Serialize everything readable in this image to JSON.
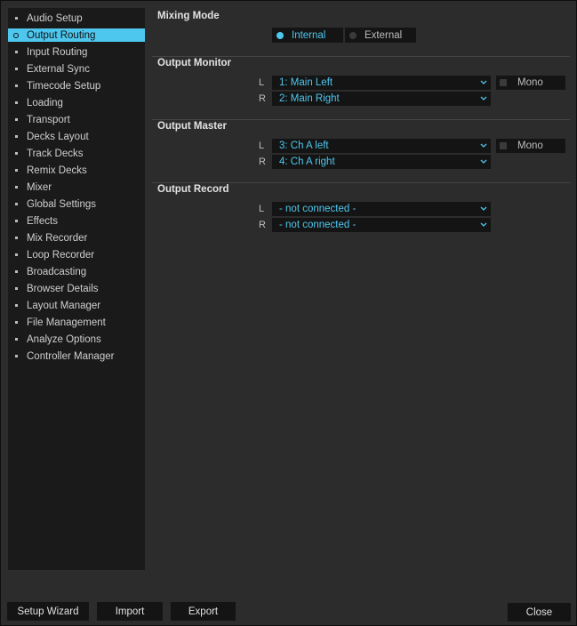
{
  "sidebar": {
    "items": [
      {
        "label": "Audio Setup"
      },
      {
        "label": "Output Routing"
      },
      {
        "label": "Input Routing"
      },
      {
        "label": "External Sync"
      },
      {
        "label": "Timecode Setup"
      },
      {
        "label": "Loading"
      },
      {
        "label": "Transport"
      },
      {
        "label": "Decks Layout"
      },
      {
        "label": "Track Decks"
      },
      {
        "label": "Remix Decks"
      },
      {
        "label": "Mixer"
      },
      {
        "label": "Global Settings"
      },
      {
        "label": "Effects"
      },
      {
        "label": "Mix Recorder"
      },
      {
        "label": "Loop Recorder"
      },
      {
        "label": "Broadcasting"
      },
      {
        "label": "Browser Details"
      },
      {
        "label": "Layout Manager"
      },
      {
        "label": "File Management"
      },
      {
        "label": "Analyze Options"
      },
      {
        "label": "Controller Manager"
      }
    ],
    "active_item": "Output Routing"
  },
  "mixing_mode": {
    "title": "Mixing Mode",
    "options": [
      {
        "label": "Internal"
      },
      {
        "label": "External"
      }
    ],
    "selected": "Internal"
  },
  "output_monitor": {
    "title": "Output Monitor",
    "left_label": "L",
    "left_value": "1: Main Left",
    "right_label": "R",
    "right_value": "2: Main Right",
    "mono_label": "Mono"
  },
  "output_master": {
    "title": "Output Master",
    "left_label": "L",
    "left_value": "3: Ch A left",
    "right_label": "R",
    "right_value": "4: Ch A right",
    "mono_label": "Mono"
  },
  "output_record": {
    "title": "Output Record",
    "left_label": "L",
    "left_value": "- not connected -",
    "right_label": "R",
    "right_value": "- not connected -"
  },
  "footer": {
    "setup_wizard": "Setup Wizard",
    "import": "Import",
    "export": "Export",
    "close": "Close"
  },
  "colors": {
    "accent": "#4ec7ee",
    "background": "#2c2c2c",
    "panel": "#1a1a1a"
  },
  "icons": {
    "dropdown": "chevron-down-icon"
  }
}
